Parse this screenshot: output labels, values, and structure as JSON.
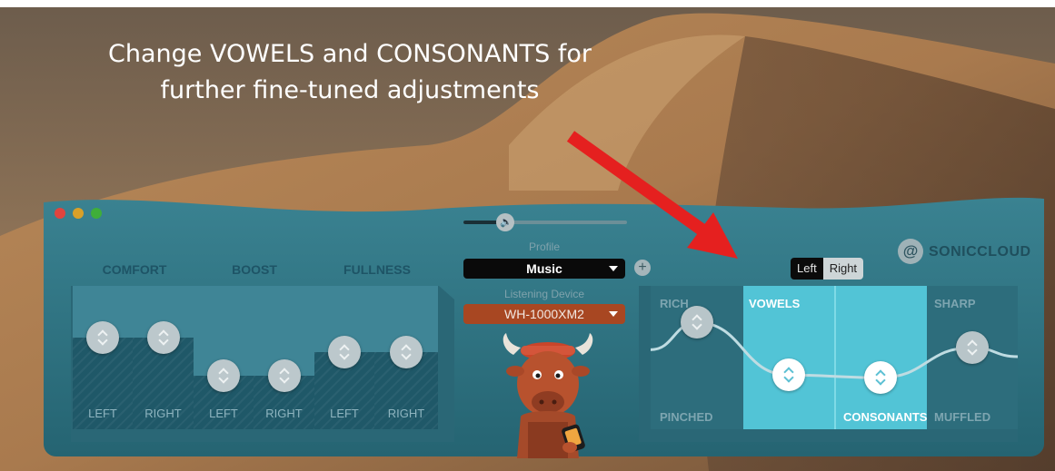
{
  "caption": {
    "line1": "Change VOWELS and CONSONANTS for",
    "line2": "further fine-tuned adjustments"
  },
  "colors": {
    "app_teal": "#2e7280",
    "highlight_cyan": "#52c4d6",
    "arrow_red": "#e5201f",
    "device_orange": "#a84722"
  },
  "left_groups": [
    {
      "label": "COMFORT",
      "sides": [
        "LEFT",
        "RIGHT"
      ]
    },
    {
      "label": "BOOST",
      "sides": [
        "LEFT",
        "RIGHT"
      ]
    },
    {
      "label": "FULLNESS",
      "sides": [
        "LEFT",
        "RIGHT"
      ]
    }
  ],
  "slider_levels": [
    0.86,
    0.86,
    0.5,
    0.5,
    0.72,
    0.72
  ],
  "center": {
    "profile_label": "Profile",
    "profile_value": "Music",
    "device_label": "Listening Device",
    "device_value": "WH-1000XM2",
    "add_icon": "+"
  },
  "right": {
    "ear_toggle": {
      "left": "Left",
      "right": "Right"
    },
    "brand": "SONICCLOUD",
    "labels": {
      "rich": "RICH",
      "pinched": "PINCHED",
      "vowels": "VOWELS",
      "consonants": "CONSONANTS",
      "sharp": "SHARP",
      "muffled": "MUFFLED"
    },
    "curve_levels": {
      "rich": 0.78,
      "vowels": 0.36,
      "consonants": 0.34,
      "sharp": 0.58
    }
  },
  "icons": [
    "speaker-icon",
    "plus-icon",
    "ear-icon",
    "bull-mascot",
    "red-arrow"
  ]
}
